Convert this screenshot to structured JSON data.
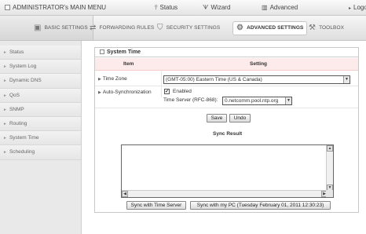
{
  "topbar": {
    "menu_title": "ADMINISTRATOR's MAIN MENU",
    "status": "Status",
    "wizard": "Wizard",
    "advanced": "Advanced",
    "logout": "Logo"
  },
  "tabs": [
    {
      "label": "BASIC SETTINGS",
      "icon": "basic-settings-icon"
    },
    {
      "label": "FORWARDING RULES",
      "icon": "forwarding-icon"
    },
    {
      "label": "SECURITY SETTINGS",
      "icon": "security-icon"
    },
    {
      "label": "ADVANCED SETTINGS",
      "icon": "advanced-settings-icon",
      "active": true
    },
    {
      "label": "TOOLBOX",
      "icon": "toolbox-icon"
    }
  ],
  "sidebar": {
    "items": [
      {
        "label": "Status"
      },
      {
        "label": "System Log"
      },
      {
        "label": "Dynamic DNS"
      },
      {
        "label": "QoS"
      },
      {
        "label": "SNMP"
      },
      {
        "label": "Routing"
      },
      {
        "label": "System Time"
      },
      {
        "label": "Scheduling"
      }
    ]
  },
  "panel": {
    "title": "System Time",
    "col_item": "Item",
    "col_setting": "Setting",
    "time_zone_label": "Time Zone",
    "time_zone_value": "(GMT-05:00) Eastern Time (US & Canada)",
    "auto_sync_label": "Auto-Synchronization",
    "enabled_label": "Enabled",
    "time_server_label": "Time Server (RFC-868):",
    "time_server_value": "0.netcomm.pool.ntp.org",
    "save_label": "Save",
    "undo_label": "Undo",
    "sync_result_title": "Sync Result",
    "sync_result_text": "",
    "sync_server_button": "Sync with Time Server",
    "sync_pc_button": "Sync with my PC (Tuesday February 01, 2011 12:30:23)"
  }
}
